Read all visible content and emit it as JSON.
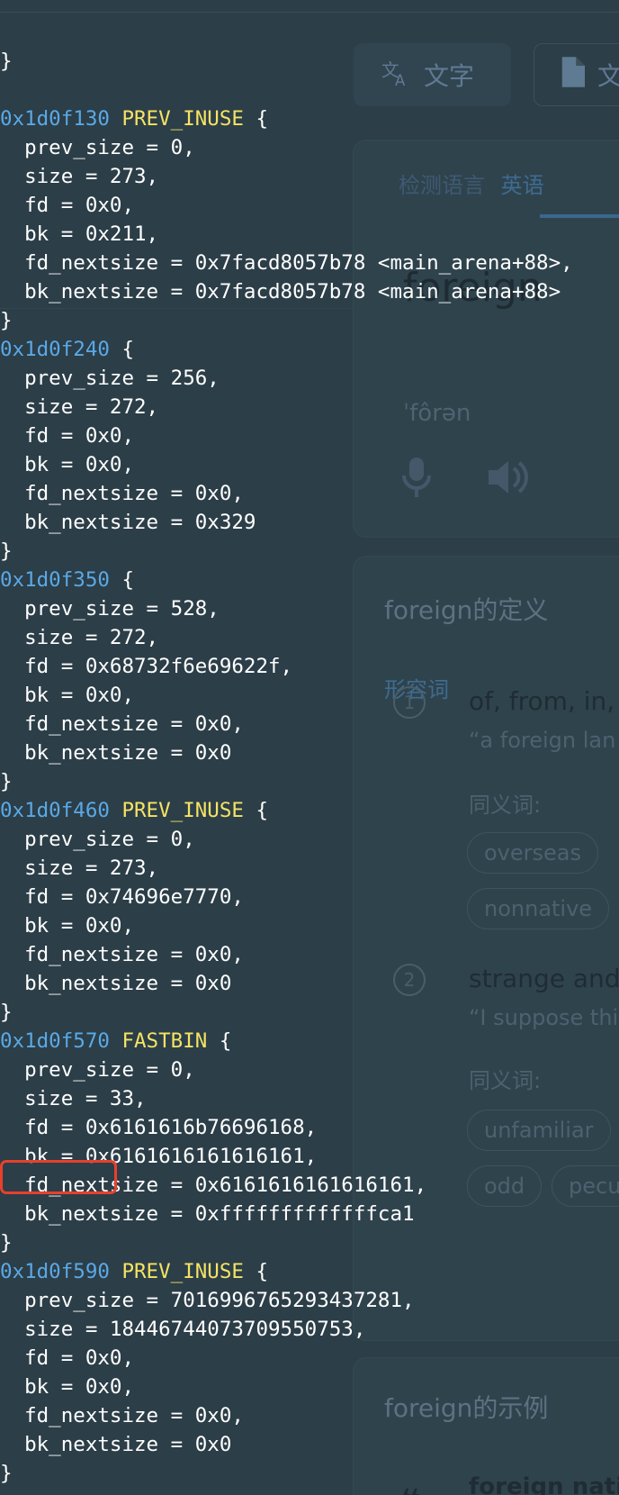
{
  "background": {
    "chips": [
      "文字",
      "文"
    ],
    "tabs": {
      "detect": "检测语言",
      "english": "英语"
    },
    "word": "foreign",
    "phonetic": "ˈfôrən",
    "definitions_title": "foreign的定义",
    "part_of_speech": "形容词",
    "senses": [
      {
        "num": "1",
        "head": "of, from, in,",
        "example": "“a foreign lan",
        "synonyms_label": "同义词:",
        "synonyms": [
          "overseas",
          "nonnative"
        ]
      },
      {
        "num": "2",
        "head": "strange and",
        "example": "“I suppose thi",
        "synonyms_label": "同义词:",
        "synonyms": [
          "unfamiliar",
          "odd",
          "pecu"
        ]
      }
    ],
    "examples_title": "foreign的示例",
    "example_text": "foreign nati"
  },
  "code_top": "}",
  "chunks": [
    {
      "addr": "0x1d0f130",
      "tag": "PREV_INUSE",
      "fields": [
        "  prev_size = 0,",
        "  size = 273,",
        "  fd = 0x0,",
        "  bk = 0x211,",
        "  fd_nextsize = 0x7facd8057b78 <main_arena+88>,",
        "  bk_nextsize = 0x7facd8057b78 <main_arena+88>"
      ],
      "close": "}"
    },
    {
      "addr": "0x1d0f240",
      "tag": "",
      "fields": [
        "  prev_size = 256,",
        "  size = 272,",
        "  fd = 0x0,",
        "  bk = 0x0,",
        "  fd_nextsize = 0x0,",
        "  bk_nextsize = 0x329"
      ],
      "close": "}"
    },
    {
      "addr": "0x1d0f350",
      "tag": "",
      "fields": [
        "  prev_size = 528,",
        "  size = 272,",
        "  fd = 0x68732f6e69622f,",
        "  bk = 0x0,",
        "  fd_nextsize = 0x0,",
        "  bk_nextsize = 0x0"
      ],
      "close": "}"
    },
    {
      "addr": "0x1d0f460",
      "tag": "PREV_INUSE",
      "fields": [
        "  prev_size = 0,",
        "  size = 273,",
        "  fd = 0x74696e7770,",
        "  bk = 0x0,",
        "  fd_nextsize = 0x0,",
        "  bk_nextsize = 0x0"
      ],
      "close": "}"
    },
    {
      "addr": "0x1d0f570",
      "tag": "FASTBIN",
      "fields": [
        "  prev_size = 0,",
        "  size = 33,",
        "  fd = 0x6161616b76696168,",
        "  bk = 0x6161616161616161,",
        "  fd_nextsize = 0x6161616161616161,",
        "  bk_nextsize = 0xfffffffffffffca1"
      ],
      "close": "}"
    },
    {
      "addr": "0x1d0f590",
      "tag": "PREV_INUSE",
      "fields": [
        "  prev_size = 7016996765293437281,",
        "  size = 18446744073709550753,",
        "  fd = 0x0,",
        "  bk = 0x0,",
        "  fd_nextsize = 0x0,",
        "  bk_nextsize = 0x0"
      ],
      "close": "}"
    }
  ],
  "colors": {
    "address": "#5aa9e6",
    "flag": "#f5e364",
    "highlight": "#e8402d"
  }
}
